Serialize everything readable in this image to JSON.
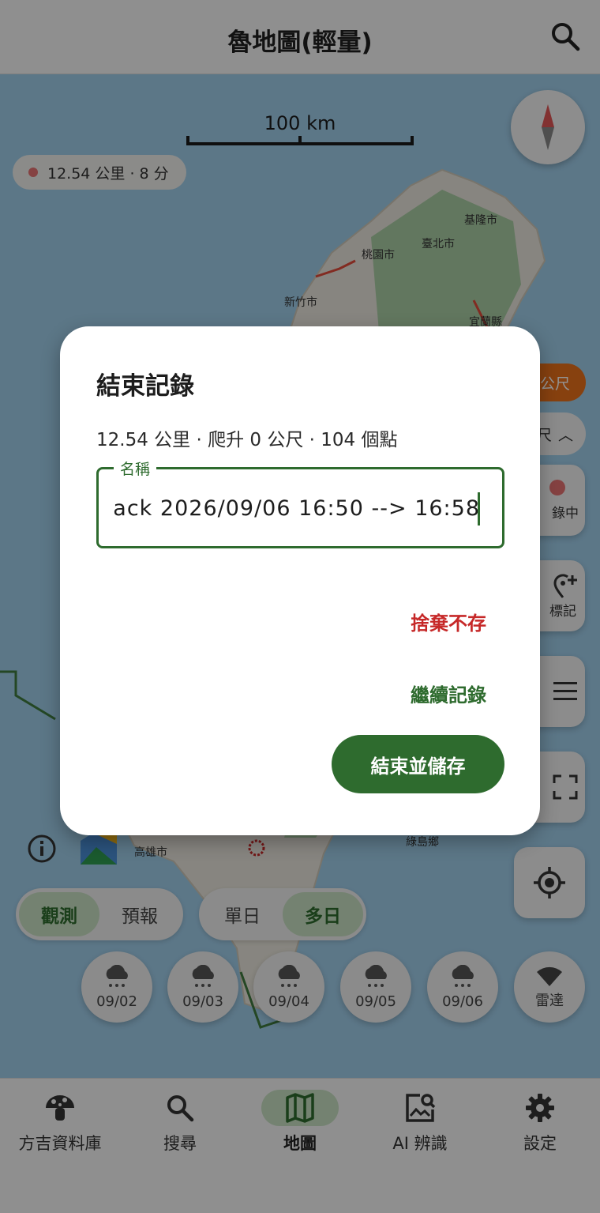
{
  "appbar": {
    "title": "魯地圖(輕量)",
    "search_icon": "search-icon"
  },
  "map": {
    "scale_label": "100 km",
    "track_summary": "12.54 公里 · 8 分",
    "cities": [
      "基隆市",
      "臺北市",
      "桃園市",
      "新竹市",
      "宜蘭縣",
      "高雄市",
      "綠島鄉"
    ],
    "distance_pill": "公尺",
    "unit_pill": "尺",
    "record_label": "錄中",
    "mark_label": "標記",
    "mode_toggle": {
      "options": [
        "觀測",
        "預報"
      ],
      "selected": "觀測"
    },
    "range_toggle": {
      "options": [
        "單日",
        "多日"
      ],
      "selected": "多日"
    },
    "days": [
      "09/02",
      "09/03",
      "09/04",
      "09/05",
      "09/06"
    ],
    "radar_label": "雷達"
  },
  "bottom_nav": {
    "items": [
      {
        "label": "方吉資料庫",
        "icon": "mushroom-icon"
      },
      {
        "label": "搜尋",
        "icon": "search-icon"
      },
      {
        "label": "地圖",
        "icon": "map-icon"
      },
      {
        "label": "AI 辨識",
        "icon": "image-search-icon"
      },
      {
        "label": "設定",
        "icon": "gear-icon"
      }
    ],
    "selected": "地圖"
  },
  "dialog": {
    "title": "結束記錄",
    "summary": "12.54 公里 · 爬升 0 公尺 · 104 個點",
    "name_label": "名稱",
    "name_value": "ack 2026/09/06 16:50 --> 16:58",
    "discard_label": "捨棄不存",
    "continue_label": "繼續記錄",
    "save_label": "結束並儲存"
  },
  "colors": {
    "primary": "#2e6b2e",
    "danger": "#c62828",
    "accent_orange": "#e8701a",
    "active_tint": "#c8e1c3"
  }
}
